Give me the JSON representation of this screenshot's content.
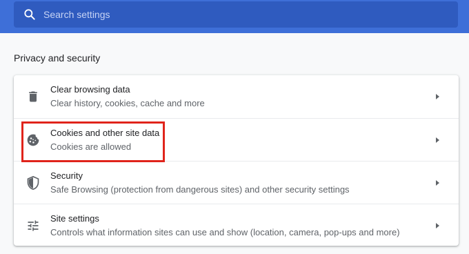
{
  "search": {
    "placeholder": "Search settings"
  },
  "section": {
    "title": "Privacy and security"
  },
  "items": [
    {
      "title": "Clear browsing data",
      "subtitle": "Clear history, cookies, cache and more",
      "icon": "trash-icon"
    },
    {
      "title": "Cookies and other site data",
      "subtitle": "Cookies are allowed",
      "icon": "cookie-icon"
    },
    {
      "title": "Security",
      "subtitle": "Safe Browsing (protection from dangerous sites) and other security settings",
      "icon": "shield-icon"
    },
    {
      "title": "Site settings",
      "subtitle": "Controls what information sites can use and show (location, camera, pop-ups and more)",
      "icon": "sliders-icon"
    }
  ],
  "colors": {
    "topbar": "#3e6fd8",
    "search_box": "#2f5bbf",
    "highlight": "#e0241b"
  }
}
